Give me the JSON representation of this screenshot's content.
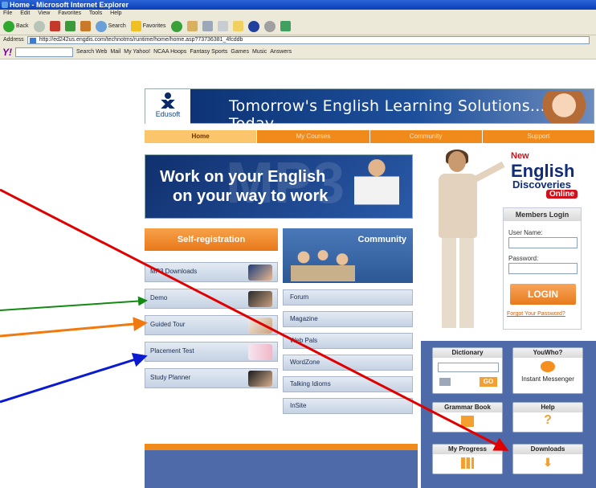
{
  "browser": {
    "window_title": "Home - Microsoft Internet Explorer",
    "menu": [
      "File",
      "Edit",
      "View",
      "Favorites",
      "Tools",
      "Help"
    ],
    "toolbar": {
      "back": "Back",
      "search": "Search",
      "favorites": "Favorites"
    },
    "address_label": "Address",
    "address_url": "http://ed242us.engdis.com/technotms/runtime/home/home.asp?73736381_4fcddb",
    "yahoo_toolbar": {
      "logo": "Y!",
      "search_web": "Search Web",
      "items": [
        "Mail",
        "My Yahoo!",
        "NCAA Hoops",
        "Fantasy Sports",
        "Games",
        "Music",
        "Answers"
      ]
    }
  },
  "site": {
    "logo_text": "Edusoft",
    "banner_slogan": "Tomorrow's English Learning Solutions... Today",
    "nav": [
      "Home",
      "My Courses",
      "Community",
      "Support"
    ],
    "mp3_banner": {
      "line1": "Work on your English",
      "line2": "on your way to work",
      "watermark": "MP3"
    },
    "self_registration": "Self-registration",
    "left_menu": [
      "MP3 Downloads",
      "Demo",
      "Guided Tour",
      "Placement Test",
      "Study Planner"
    ],
    "community": {
      "title": "Community",
      "items": [
        "Forum",
        "Magazine",
        "Web Pals",
        "WordZone",
        "Talking Idioms",
        "InSite"
      ]
    },
    "ed_logo": {
      "new": "New",
      "english": "English",
      "discoveries": "Discoveries",
      "online": "Online"
    },
    "login": {
      "title": "Members Login",
      "username_label": "User Name:",
      "password_label": "Password:",
      "button": "LOGIN",
      "forgot": "Forgot Your Password?"
    },
    "tools": [
      {
        "title": "Dictionary",
        "extra": "GO"
      },
      {
        "title": "YouWho?",
        "extra": "Instant Messenger"
      },
      {
        "title": "Grammar Book"
      },
      {
        "title": "Help"
      },
      {
        "title": "My Progress"
      },
      {
        "title": "Downloads"
      }
    ]
  },
  "colors": {
    "nav_orange": "#f08a1a",
    "panel_blue": "#4e6aa8",
    "arrow_red": "#e00000",
    "arrow_green": "#138a13",
    "arrow_orange": "#f07a10",
    "arrow_blue": "#0a1ad0"
  }
}
